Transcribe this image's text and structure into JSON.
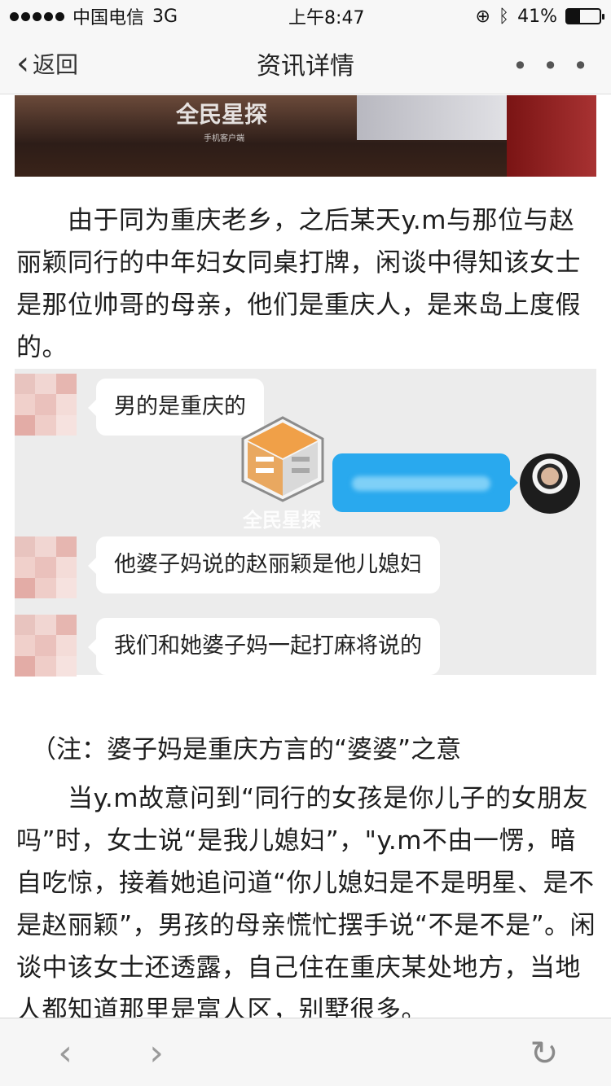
{
  "status_bar": {
    "carrier": "中国电信",
    "network": "3G",
    "time": "上午8:47",
    "battery_percent": "41%",
    "battery_level": 0.41
  },
  "nav": {
    "back_label": "返回",
    "title": "资讯详情",
    "more_label": "• • •"
  },
  "hero_image": {
    "watermark": "全民星探",
    "watermark_sub": "手机客户端"
  },
  "article": {
    "paragraph1": "　　由于同为重庆老乡，之后某天y.m与那位与赵丽颖同行的中年妇女同桌打牌，闲谈中得知该女士是那位帅哥的母亲，他们是重庆人，是来岛上度假的。",
    "chat": {
      "messages": [
        {
          "text": "男的是重庆的"
        },
        {
          "text": "他婆子妈说的赵丽颖是他儿媳妇"
        },
        {
          "text": "我们和她婆子妈一起打麻将说的"
        }
      ],
      "watermark": "全民星探"
    },
    "note": "（注：婆子妈是重庆方言的“婆婆”之意",
    "paragraph2": "　　当y.m故意问到“同行的女孩是你儿子的女朋友吗”时，女士说“是我儿媳妇”，\"y.m不由一愣，暗自吃惊，接着她追问道“你儿媳妇是不是明星、是不是赵丽颖”，男孩的母亲慌忙摆手说“不是不是”。闲谈中该女士还透露，自己住在重庆某处地方，当地人都知道那里是富人区，别墅很多。"
  },
  "toolbar": {
    "back_icon": "‹",
    "forward_icon": "›",
    "reload_icon": "↻"
  }
}
